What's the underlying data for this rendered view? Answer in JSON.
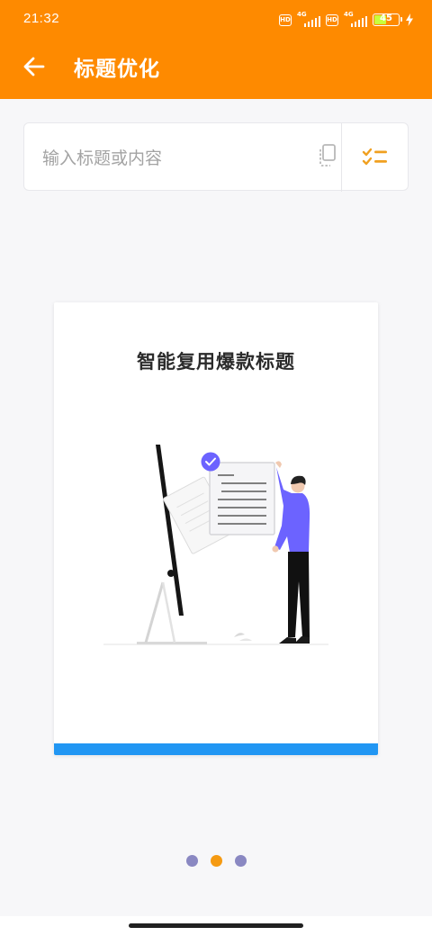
{
  "status_bar": {
    "time": "21:32",
    "hd_label": "HD",
    "network_label": "4G",
    "battery_level": "45",
    "battery_fill_color": "#c9ff3b"
  },
  "app_bar": {
    "title": "标题优化",
    "back_icon": "arrow-left-icon",
    "background_color": "#fe8a00"
  },
  "search": {
    "placeholder": "输入标题或内容",
    "paste_icon": "paste-icon",
    "checklist_icon": "checklist-icon"
  },
  "feature_card": {
    "title": "智能复用爆款标题",
    "bar_color": "#2196f3"
  },
  "pager": {
    "page_count": 3,
    "active_index": 1,
    "active_color": "#f59a12",
    "inactive_color": "#8a88c2"
  }
}
